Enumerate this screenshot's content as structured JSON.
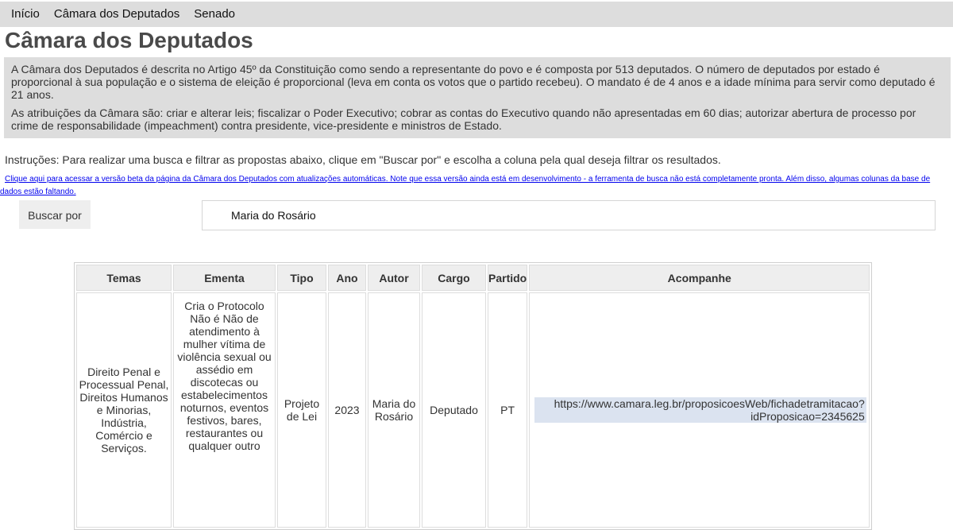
{
  "nav": {
    "items": [
      "Início",
      "Câmara dos Deputados",
      "Senado"
    ]
  },
  "page": {
    "title": "Câmara dos Deputados"
  },
  "info": {
    "paragraph1": "A Câmara dos Deputados é descrita no Artigo 45º da Constituição como sendo a representante do povo e é composta por 513 deputados. O número de deputados por estado é proporcional à sua população e o sistema de eleição é proporcional (leva em conta os votos que o partido recebeu). O mandato é de 4 anos e a idade mínima para servir como deputado é 21 anos.",
    "paragraph2": "As atribuições da Câmara são: criar e alterar leis; fiscalizar o Poder Executivo; cobrar as contas do Executivo quando não apresentadas em 60 dias; autorizar abertura de processo por crime de responsabilidade (impeachment) contra presidente, vice-presidente e ministros de Estado."
  },
  "instructions": "Instruções: Para realizar uma busca e filtrar as propostas abaixo, clique em \"Buscar por\" e escolha a coluna pela qual deseja filtrar os resultados.",
  "beta_link": "Clique aqui para acessar a versão beta da página da Câmara dos Deputados com atualizações automáticas. Note que essa versão ainda está em desenvolvimento - a ferramenta de busca não está completamente pronta. Além disso, algumas colunas da base de dados estão faltando.",
  "search": {
    "button_label": "Buscar por",
    "value": "Maria do Rosário"
  },
  "table": {
    "headers": [
      "Temas",
      "Ementa",
      "Tipo",
      "Ano",
      "Autor",
      "Cargo",
      "Partido",
      "Acompanhe"
    ],
    "rows": [
      {
        "temas": "Direito Penal e Processual Penal, Direitos Humanos e Minorias, Indústria, Comércio e Serviços.",
        "ementa": "Cria o Protocolo Não é Não de atendimento à mulher vítima de violência sexual ou assédio em discotecas ou estabelecimentos noturnos, eventos festivos, bares, restaurantes ou qualquer outro",
        "tipo": "Projeto de Lei",
        "ano": "2023",
        "autor": "Maria do Rosário",
        "cargo": "Deputado",
        "partido": "PT",
        "acompanhe": "https://www.camara.leg.br/proposicoesWeb/fichadetramitacao?idProposicao=2345625"
      }
    ]
  }
}
